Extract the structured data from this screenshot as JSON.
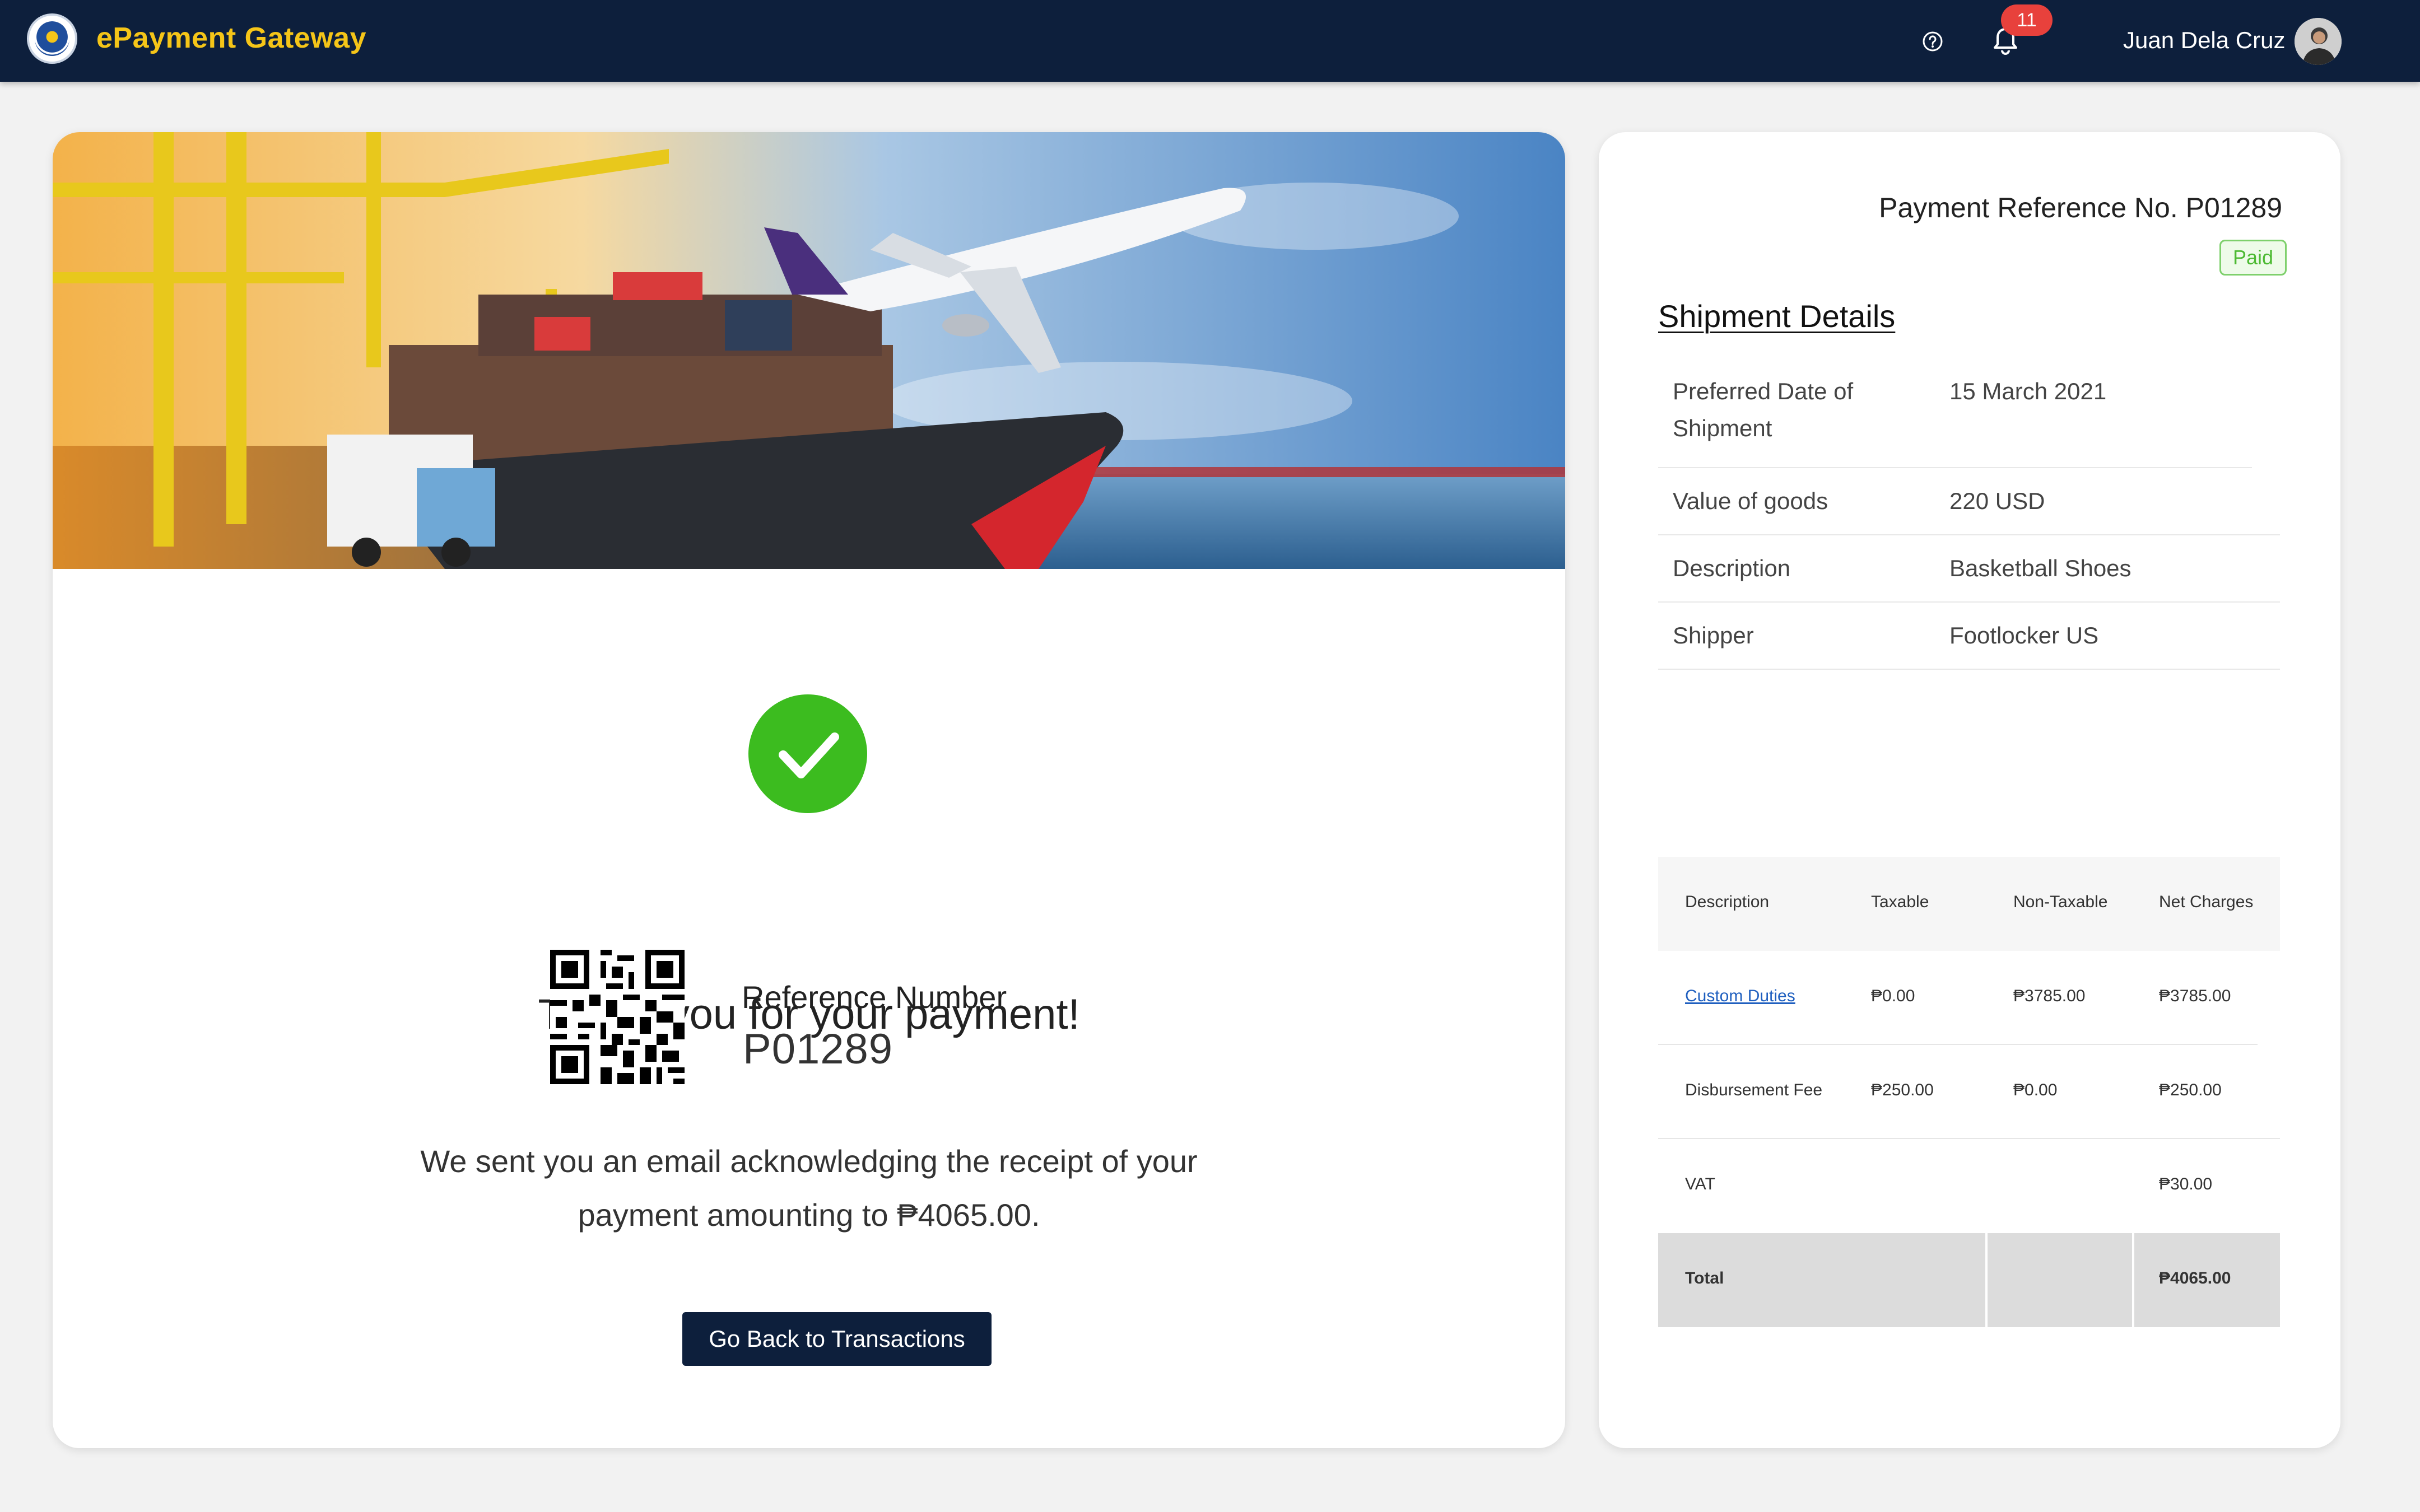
{
  "header": {
    "brand": "ePayment Gateway",
    "notification_count": "11",
    "user_name": "Juan Dela Cruz"
  },
  "success": {
    "thanks": "Thank you for your payment!",
    "reference_label": "Reference Number",
    "reference_number": "P01289",
    "email_line1": "We sent you an email acknowledging the receipt of your",
    "email_line2": "payment amounting to ₱4065.00.",
    "back_button": "Go Back to Transactions"
  },
  "summary": {
    "payment_reference": "Payment  Reference No. P01289",
    "status": "Paid",
    "shipment_title": "Shipment Details",
    "shipment": [
      {
        "label_line1": "Preferred Date  of",
        "label_line2": "Shipment",
        "value": "15 March 2021"
      },
      {
        "label": "Value of goods",
        "value": "220 USD"
      },
      {
        "label": "Description",
        "value": "Basketball Shoes"
      },
      {
        "label": "Shipper",
        "value": "Footlocker US"
      }
    ],
    "charges": {
      "headers": [
        "Description",
        "Taxable",
        "Non-Taxable",
        "Net Charges"
      ],
      "rows": [
        {
          "description": "Custom Duties",
          "taxable": "₱0.00",
          "non_taxable": "₱3785.00",
          "net": "₱3785.00"
        },
        {
          "description": "Disbursement Fee",
          "taxable": "₱250.00",
          "non_taxable": "₱0.00",
          "net": "₱250.00"
        },
        {
          "description": "VAT",
          "taxable": "",
          "non_taxable": "",
          "net": "₱30.00"
        }
      ],
      "total": {
        "label": "Total",
        "net": "₱4065.00"
      }
    }
  },
  "colors": {
    "navy": "#0d1f3c",
    "brand_yellow": "#f5c518",
    "success_green": "#3cbc1f",
    "badge_red": "#e8413c",
    "link_blue": "#1f5fbf"
  },
  "icons": [
    "seal-logo-icon",
    "help-icon",
    "bell-icon",
    "check-icon",
    "qr-code-icon",
    "user-avatar-icon"
  ]
}
